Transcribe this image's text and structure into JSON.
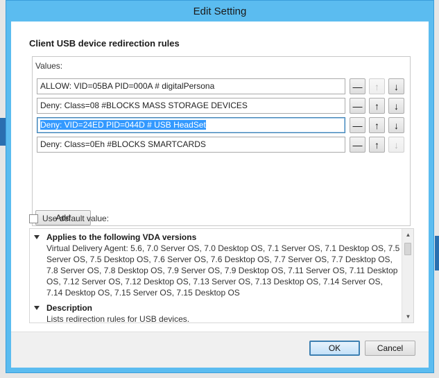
{
  "window": {
    "title": "Edit Setting"
  },
  "heading": "Client USB device redirection rules",
  "values_label": "Values:",
  "rules": [
    {
      "value": "ALLOW: VID=05BA PID=000A # digitalPersona",
      "up_enabled": false,
      "down_enabled": true,
      "focused": false
    },
    {
      "value": "Deny: Class=08 #BLOCKS MASS STORAGE DEVICES",
      "up_enabled": true,
      "down_enabled": true,
      "focused": false
    },
    {
      "value": "Deny: VID=24ED PID=044D # USB HeadSet",
      "up_enabled": true,
      "down_enabled": true,
      "focused": true
    },
    {
      "value": "Deny: Class=0Eh #BLOCKS SMARTCARDS",
      "up_enabled": true,
      "down_enabled": false,
      "focused": false
    }
  ],
  "buttons": {
    "remove_glyph": "—",
    "up_glyph": "↑",
    "down_glyph": "↓",
    "add": "Add",
    "ok": "OK",
    "cancel": "Cancel"
  },
  "use_default": {
    "label": "Use default value:",
    "checked": false
  },
  "info": {
    "sections": [
      {
        "title": "Applies to the following VDA versions",
        "body": "Virtual Delivery Agent: 5.6, 7.0 Server OS, 7.0 Desktop OS, 7.1 Server OS, 7.1 Desktop OS, 7.5 Server OS, 7.5 Desktop OS, 7.6 Server OS, 7.6 Desktop OS, 7.7 Server OS, 7.7 Desktop OS, 7.8 Server OS, 7.8 Desktop OS, 7.9 Server OS, 7.9 Desktop OS, 7.11 Server OS, 7.11 Desktop OS, 7.12 Server OS, 7.12 Desktop OS, 7.13 Server OS, 7.13 Desktop OS, 7.14 Server OS, 7.14 Desktop OS, 7.15 Server OS, 7.15 Desktop OS"
      },
      {
        "title": "Description",
        "body": "Lists redirection rules for USB devices."
      }
    ]
  },
  "colors": {
    "title_bar": "#5bbcf0",
    "selection": "#3399ff",
    "focus_border": "#3c7fb1",
    "background_accent": "#2a6fb0"
  }
}
